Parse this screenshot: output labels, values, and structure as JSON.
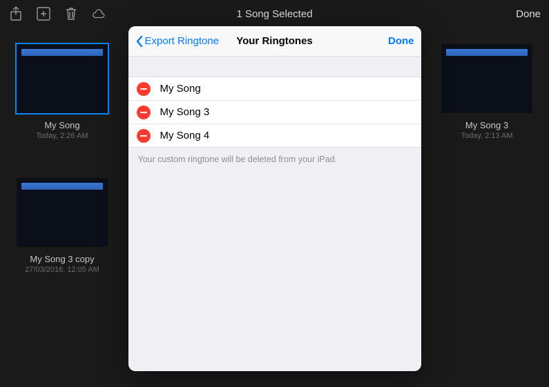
{
  "topbar": {
    "title": "1 Song Selected",
    "done": "Done"
  },
  "songs": [
    {
      "title": "My Song",
      "meta": "Today, 2:26 AM",
      "selected": true
    },
    {
      "title": "My Song 3",
      "meta": "Today, 2:13 AM",
      "selected": false
    },
    {
      "title": "My Song 3 copy",
      "meta": "27/03/2016, 12:05 AM",
      "selected": false
    }
  ],
  "modal": {
    "back": "Export Ringtone",
    "title": "Your Ringtones",
    "done": "Done",
    "rows": [
      {
        "label": "My Song"
      },
      {
        "label": "My Song 3"
      },
      {
        "label": "My Song 4"
      }
    ],
    "footnote": "Your custom ringtone will be deleted from your iPad."
  }
}
